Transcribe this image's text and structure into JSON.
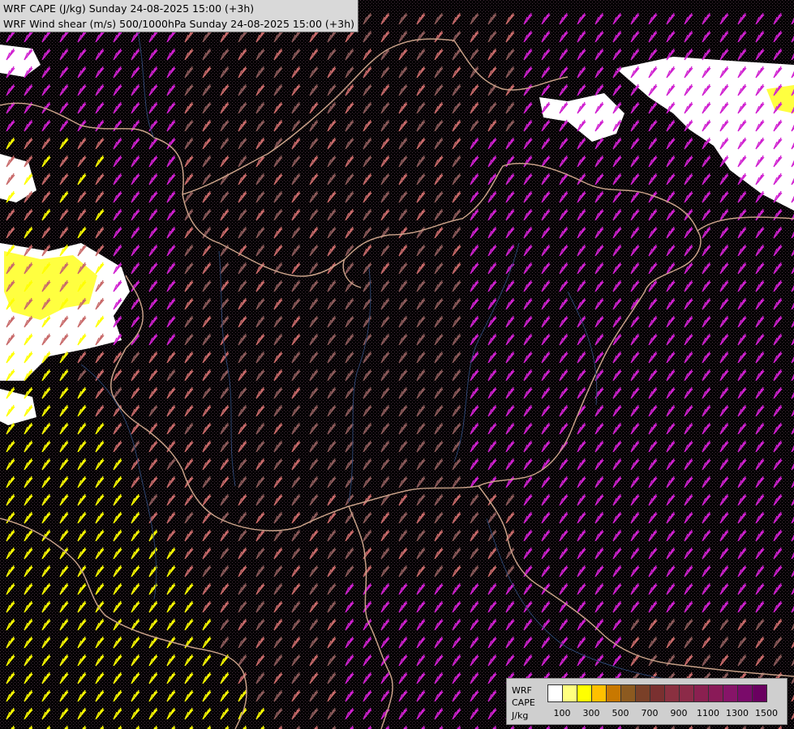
{
  "header": {
    "line1": "WRF CAPE (J/kg) Sunday 24-08-2025 15:00 (+3h)",
    "line2": "WRF Wind shear (m/s) 500/1000hPa Sunday 24-08-2025 15:00 (+3h)"
  },
  "legend": {
    "label_line1": "WRF",
    "label_line2": "CAPE",
    "label_line3": "J/kg",
    "ticks": [
      "100",
      "300",
      "500",
      "700",
      "900",
      "1100",
      "1300",
      "1500"
    ],
    "colors": [
      "#ffffff",
      "#ffff80",
      "#ffff00",
      "#ffc000",
      "#c87800",
      "#8c5a20",
      "#7a4028",
      "#7a3030",
      "#8a3040",
      "#8c2a48",
      "#8a2050",
      "#8a1a58",
      "#861468",
      "#7a0a6a",
      "#6a0060"
    ]
  },
  "map_colors": {
    "background": "#000000",
    "stipple": "#4a3040",
    "border": "#c8a088",
    "river": "#2c4470",
    "barb_low": "#8c5a5a",
    "barb_mid": "#c86a6a",
    "barb_high": "#d020d0",
    "barb_cape": "#ffff00",
    "cape_white": "#ffffff"
  }
}
